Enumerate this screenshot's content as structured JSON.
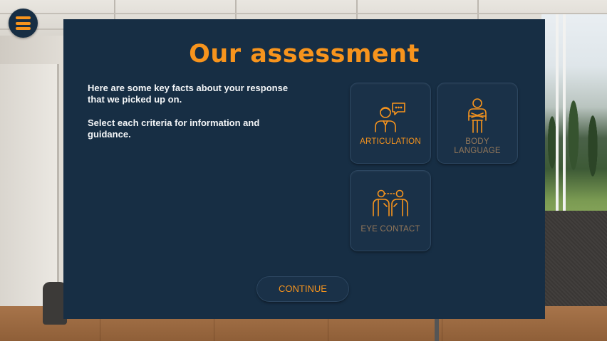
{
  "modal": {
    "title": "Our assessment",
    "intro": [
      "Here are some key facts about your response that we picked up on.",
      "Select each criteria for information and guidance."
    ],
    "criteria": [
      {
        "label": "ARTICULATION",
        "icon": "speaking-person-icon",
        "state": "active"
      },
      {
        "label": "BODY\nLANGUAGE",
        "icon": "standing-person-icon",
        "state": "dim"
      },
      {
        "label": "EYE CONTACT",
        "icon": "eye-contact-icon",
        "state": "dim"
      }
    ],
    "continue_label": "CONTINUE"
  },
  "menu": {
    "icon": "hamburger-menu-icon"
  },
  "colors": {
    "accent": "#f7941d",
    "panel": "#172e44",
    "card": "#1a3148",
    "dim_label": "#93775a",
    "text": "#ffffff"
  }
}
